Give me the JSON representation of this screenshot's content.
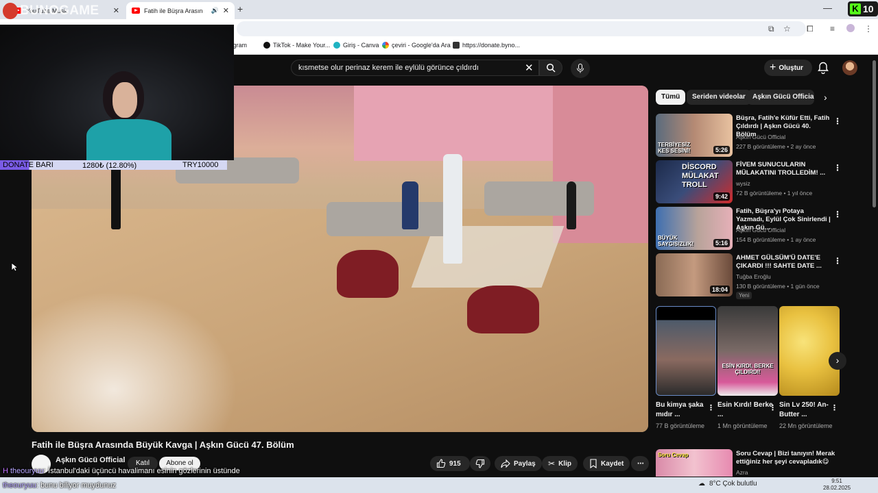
{
  "browser": {
    "tabs": [
      {
        "label": "YouTube Music"
      },
      {
        "label": "Fatih ile Büşra Arasında Büy"
      }
    ],
    "bookmarks": [
      {
        "label": "Instagram"
      },
      {
        "label": "TikTok - Make Your..."
      },
      {
        "label": "Giriş - Canva"
      },
      {
        "label": "çeviri - Google'da Ara"
      },
      {
        "label": "https://donate.byno..."
      }
    ],
    "kick_badge": "10"
  },
  "stream": {
    "logo": "BUNOGAME",
    "donate": {
      "label": "DONATE BARI",
      "amount": "1280₺ (12.80%)",
      "goal": "TRY10000",
      "progress_pct": 12.8
    },
    "chat": [
      {
        "user": "theouryuu",
        "message": "İstanbul'daki üçüncü havalimanı esinin gözlerinin üstünde"
      },
      {
        "user": "theouryuu",
        "message": "bunu biliyor muydunuz"
      }
    ]
  },
  "youtube": {
    "search_query": "kısmetse olur perinaz kerem ile eylülü görünce çıldırdı",
    "create_label": "Oluştur",
    "video": {
      "title": "Fatih ile Büşra Arasında Büyük Kavga | Aşkın Gücü 47. Bölüm",
      "channel": "Aşkın Gücü Official",
      "join_label": "Katıl",
      "subscribe_label": "Abone ol",
      "likes": "915",
      "share_label": "Paylaş",
      "clip_label": "Klip",
      "save_label": "Kaydet"
    },
    "chips": [
      "Tümü",
      "Seriden videolar",
      "Aşkın Gücü Official"
    ],
    "recommended": [
      {
        "title": "Büşra, Fatih'e Küfür Etti, Fatih Çıldırdı | Aşkın Gücü 40. Bölüm",
        "channel": "Aşkın Gücü Official",
        "meta": "227 B görüntüleme • 2 ay önce",
        "duration": "5:26",
        "thumb_caption": "TERBİYESİZ KES SESİNİ!"
      },
      {
        "title": "FİVEM SUNUCULARIN MÜLAKATINI TROLLEDİM! ...",
        "channel": "wysiz",
        "meta": "72 B görüntüleme • 1 yıl önce",
        "duration": "9:42",
        "thumb_caption": "DİSCORD MÜLAKAT TROLL"
      },
      {
        "title": "Fatih, Büşra'yı Potaya Yazmadı, Eylül Çok Sinirlendi | Aşkın Gü...",
        "channel": "Aşkın Gücü Official",
        "meta": "154 B görüntüleme • 1 ay önce",
        "duration": "5:16",
        "thumb_caption": "BÜYÜK SAYGISIZLIK!"
      },
      {
        "title": "AHMET GÜLSÜM'Ü DATE'E ÇIKARDI !!! SAHTE DATE ...",
        "channel": "Tuğba Eroğlu",
        "meta": "130 B görüntüleme • 1 gün önce",
        "duration": "18:04",
        "badge": "Yeni",
        "thumb_caption": ""
      }
    ],
    "shorts": [
      {
        "title": "Bu kimya şaka mıdır ...",
        "views": "77 B görüntüleme"
      },
      {
        "title": "Esin Kırdı! Berke ...",
        "views": "1 Mn görüntüleme",
        "thumb_caption": "ESİN KIRDI, BERKE ÇILDIRDI!"
      },
      {
        "title": "Sin Lv 250! An-Butter ...",
        "views": "22 Mn görüntüleme"
      }
    ],
    "bottom_rec": {
      "title": "Soru Cevap | Bizi tanıyın! Merak ettiğiniz her şeyi cevapladık😋",
      "channel": "Azra",
      "thumb_caption": "Soru Cevap"
    }
  },
  "taskbar": {
    "weather": "8°C  Çok bulutlu",
    "time": "9:51",
    "date": "28.02.2025"
  },
  "colors": {
    "accent_red": "#ff0000",
    "donate_purple": "#7a5ce6",
    "kick_green": "#53fc18"
  }
}
